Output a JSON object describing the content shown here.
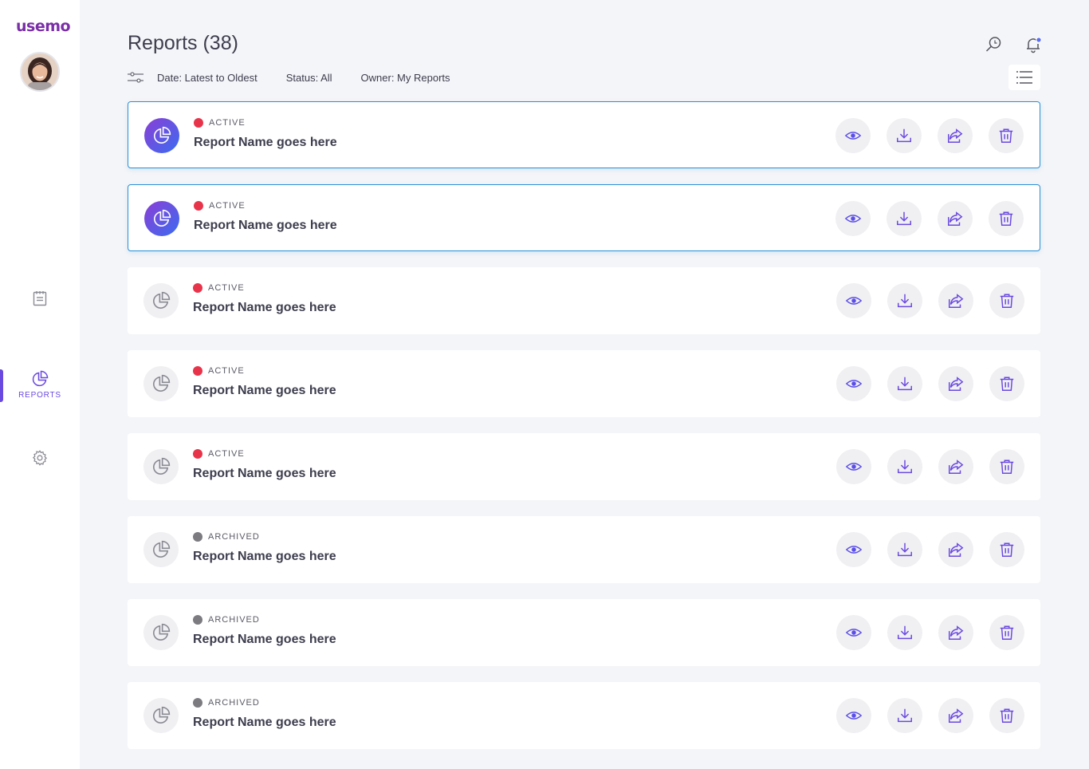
{
  "app": {
    "logo": "usemo"
  },
  "sidebar": {
    "items": [
      {
        "name": "notes",
        "label": ""
      },
      {
        "name": "reports",
        "label": "REPORTS",
        "active": true
      },
      {
        "name": "settings",
        "label": ""
      }
    ]
  },
  "header": {
    "title": "Reports (38)",
    "filters": {
      "date": "Date: Latest to Oldest",
      "status": "Status: All",
      "owner": "Owner: My Reports"
    }
  },
  "colors": {
    "accent": "#6a49e0",
    "active_dot": "#e8344a",
    "archived_dot": "#7b7b80",
    "selected_border": "#2b8fd6"
  },
  "reports": [
    {
      "status": "ACTIVE",
      "name": "Report Name goes here",
      "selected": true
    },
    {
      "status": "ACTIVE",
      "name": "Report Name goes here",
      "selected": true
    },
    {
      "status": "ACTIVE",
      "name": "Report Name goes here",
      "selected": false
    },
    {
      "status": "ACTIVE",
      "name": "Report Name goes here",
      "selected": false
    },
    {
      "status": "ACTIVE",
      "name": "Report Name goes here",
      "selected": false
    },
    {
      "status": "ARCHIVED",
      "name": "Report Name goes here",
      "selected": false
    },
    {
      "status": "ARCHIVED",
      "name": "Report Name goes here",
      "selected": false
    },
    {
      "status": "ARCHIVED",
      "name": "Report Name goes here",
      "selected": false
    }
  ],
  "report_actions": [
    "view-icon",
    "download-icon",
    "share-icon",
    "delete-icon"
  ]
}
